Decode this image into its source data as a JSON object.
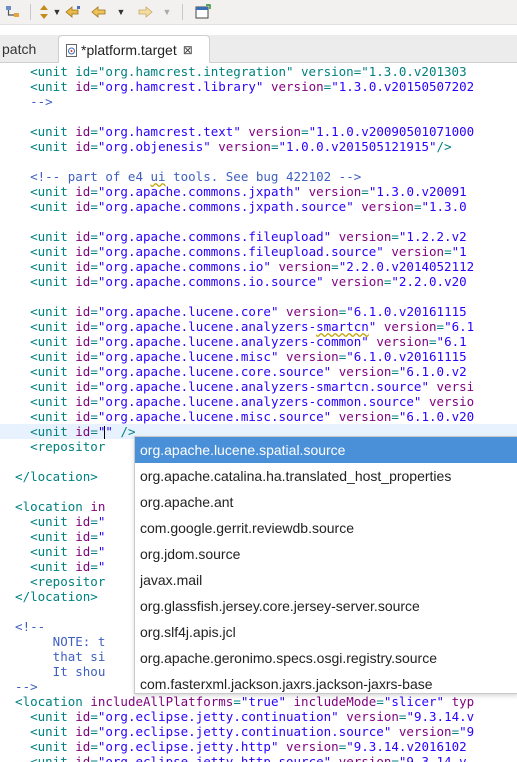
{
  "toolbar": {
    "icons": [
      "tree-hierarchy-icon",
      "last-edit-icon",
      "back-icon",
      "forward-icon",
      "new-window-icon"
    ]
  },
  "tabs": {
    "inactive_label": "patch",
    "active_label": "*platform.target",
    "close_glyph": "⊠"
  },
  "editor": {
    "lines": [
      [
        {
          "t": "    <unit id=\"org.hamcrest.integration\" version=\"1.3.0.v201303",
          "c": "tag"
        }
      ],
      [
        {
          "t": "    <unit ",
          "c": "tag"
        },
        {
          "t": "id",
          "c": "attr"
        },
        {
          "t": "=",
          "c": "tag"
        },
        {
          "t": "\"org.hamcrest.library\"",
          "c": "val"
        },
        {
          "t": " ",
          "c": "tag"
        },
        {
          "t": "version",
          "c": "attr"
        },
        {
          "t": "=",
          "c": "tag"
        },
        {
          "t": "\"1.3.0.v20150507202",
          "c": "val"
        }
      ],
      [
        {
          "t": "    -->",
          "c": "cmt"
        }
      ],
      [
        {
          "t": "",
          "c": "tag"
        }
      ],
      [
        {
          "t": "    <unit ",
          "c": "tag"
        },
        {
          "t": "id",
          "c": "attr"
        },
        {
          "t": "=",
          "c": "tag"
        },
        {
          "t": "\"org.hamcrest.text\"",
          "c": "val"
        },
        {
          "t": " ",
          "c": "tag"
        },
        {
          "t": "version",
          "c": "attr"
        },
        {
          "t": "=",
          "c": "tag"
        },
        {
          "t": "\"1.1.0.v20090501071000",
          "c": "val"
        }
      ],
      [
        {
          "t": "    <unit ",
          "c": "tag"
        },
        {
          "t": "id",
          "c": "attr"
        },
        {
          "t": "=",
          "c": "tag"
        },
        {
          "t": "\"org.objenesis\"",
          "c": "val"
        },
        {
          "t": " ",
          "c": "tag"
        },
        {
          "t": "version",
          "c": "attr"
        },
        {
          "t": "=",
          "c": "tag"
        },
        {
          "t": "\"1.0.0.v201505121915\"",
          "c": "val"
        },
        {
          "t": "/>",
          "c": "tag"
        }
      ],
      [
        {
          "t": "",
          "c": "tag"
        }
      ],
      [
        {
          "t": "    <!-- part of e4 ",
          "c": "cmt"
        },
        {
          "t": "ui",
          "c": "cmt ul"
        },
        {
          "t": " tools. See bug 422102 -->",
          "c": "cmt"
        }
      ],
      [
        {
          "t": "    <unit ",
          "c": "tag"
        },
        {
          "t": "id",
          "c": "attr"
        },
        {
          "t": "=",
          "c": "tag"
        },
        {
          "t": "\"org.apache.commons.jxpath\"",
          "c": "val"
        },
        {
          "t": " ",
          "c": "tag"
        },
        {
          "t": "version",
          "c": "attr"
        },
        {
          "t": "=",
          "c": "tag"
        },
        {
          "t": "\"1.3.0.v20091",
          "c": "val"
        }
      ],
      [
        {
          "t": "    <unit ",
          "c": "tag"
        },
        {
          "t": "id",
          "c": "attr"
        },
        {
          "t": "=",
          "c": "tag"
        },
        {
          "t": "\"org.apache.commons.jxpath.source\"",
          "c": "val"
        },
        {
          "t": " ",
          "c": "tag"
        },
        {
          "t": "version",
          "c": "attr"
        },
        {
          "t": "=",
          "c": "tag"
        },
        {
          "t": "\"1.3.0",
          "c": "val"
        }
      ],
      [
        {
          "t": "",
          "c": "tag"
        }
      ],
      [
        {
          "t": "    <unit ",
          "c": "tag"
        },
        {
          "t": "id",
          "c": "attr"
        },
        {
          "t": "=",
          "c": "tag"
        },
        {
          "t": "\"org.apache.commons.fileupload\"",
          "c": "val"
        },
        {
          "t": " ",
          "c": "tag"
        },
        {
          "t": "version",
          "c": "attr"
        },
        {
          "t": "=",
          "c": "tag"
        },
        {
          "t": "\"1.2.2.v2",
          "c": "val"
        }
      ],
      [
        {
          "t": "    <unit ",
          "c": "tag"
        },
        {
          "t": "id",
          "c": "attr"
        },
        {
          "t": "=",
          "c": "tag"
        },
        {
          "t": "\"org.apache.commons.fileupload.source\"",
          "c": "val"
        },
        {
          "t": " ",
          "c": "tag"
        },
        {
          "t": "version",
          "c": "attr"
        },
        {
          "t": "=",
          "c": "tag"
        },
        {
          "t": "\"1",
          "c": "val"
        }
      ],
      [
        {
          "t": "    <unit ",
          "c": "tag"
        },
        {
          "t": "id",
          "c": "attr"
        },
        {
          "t": "=",
          "c": "tag"
        },
        {
          "t": "\"org.apache.commons.io\"",
          "c": "val"
        },
        {
          "t": " ",
          "c": "tag"
        },
        {
          "t": "version",
          "c": "attr"
        },
        {
          "t": "=",
          "c": "tag"
        },
        {
          "t": "\"2.2.0.v2014052112",
          "c": "val"
        }
      ],
      [
        {
          "t": "    <unit ",
          "c": "tag"
        },
        {
          "t": "id",
          "c": "attr"
        },
        {
          "t": "=",
          "c": "tag"
        },
        {
          "t": "\"org.apache.commons.io.source\"",
          "c": "val"
        },
        {
          "t": " ",
          "c": "tag"
        },
        {
          "t": "version",
          "c": "attr"
        },
        {
          "t": "=",
          "c": "tag"
        },
        {
          "t": "\"2.2.0.v20",
          "c": "val"
        }
      ],
      [
        {
          "t": "",
          "c": "tag"
        }
      ],
      [
        {
          "t": "    <unit ",
          "c": "tag"
        },
        {
          "t": "id",
          "c": "attr"
        },
        {
          "t": "=",
          "c": "tag"
        },
        {
          "t": "\"org.apache.lucene.core\"",
          "c": "val"
        },
        {
          "t": " ",
          "c": "tag"
        },
        {
          "t": "version",
          "c": "attr"
        },
        {
          "t": "=",
          "c": "tag"
        },
        {
          "t": "\"6.1.0.v20161115",
          "c": "val"
        }
      ],
      [
        {
          "t": "    <unit ",
          "c": "tag"
        },
        {
          "t": "id",
          "c": "attr"
        },
        {
          "t": "=",
          "c": "tag"
        },
        {
          "t": "\"org.apache.lucene.analyzers-",
          "c": "val"
        },
        {
          "t": "smartcn",
          "c": "val ul"
        },
        {
          "t": "\"",
          "c": "val"
        },
        {
          "t": " ",
          "c": "tag"
        },
        {
          "t": "version",
          "c": "attr"
        },
        {
          "t": "=",
          "c": "tag"
        },
        {
          "t": "\"6.1",
          "c": "val"
        }
      ],
      [
        {
          "t": "    <unit ",
          "c": "tag"
        },
        {
          "t": "id",
          "c": "attr"
        },
        {
          "t": "=",
          "c": "tag"
        },
        {
          "t": "\"org.apache.lucene.analyzers-common\"",
          "c": "val"
        },
        {
          "t": " ",
          "c": "tag"
        },
        {
          "t": "version",
          "c": "attr"
        },
        {
          "t": "=",
          "c": "tag"
        },
        {
          "t": "\"6.1",
          "c": "val"
        }
      ],
      [
        {
          "t": "    <unit ",
          "c": "tag"
        },
        {
          "t": "id",
          "c": "attr"
        },
        {
          "t": "=",
          "c": "tag"
        },
        {
          "t": "\"org.apache.lucene.misc\"",
          "c": "val"
        },
        {
          "t": " ",
          "c": "tag"
        },
        {
          "t": "version",
          "c": "attr"
        },
        {
          "t": "=",
          "c": "tag"
        },
        {
          "t": "\"6.1.0.v20161115",
          "c": "val"
        }
      ],
      [
        {
          "t": "    <unit ",
          "c": "tag"
        },
        {
          "t": "id",
          "c": "attr"
        },
        {
          "t": "=",
          "c": "tag"
        },
        {
          "t": "\"org.apache.lucene.core.source\"",
          "c": "val"
        },
        {
          "t": " ",
          "c": "tag"
        },
        {
          "t": "version",
          "c": "attr"
        },
        {
          "t": "=",
          "c": "tag"
        },
        {
          "t": "\"6.1.0.v2",
          "c": "val"
        }
      ],
      [
        {
          "t": "    <unit ",
          "c": "tag"
        },
        {
          "t": "id",
          "c": "attr"
        },
        {
          "t": "=",
          "c": "tag"
        },
        {
          "t": "\"org.apache.lucene.analyzers-smartcn.source\"",
          "c": "val"
        },
        {
          "t": " ",
          "c": "tag"
        },
        {
          "t": "versi",
          "c": "attr"
        }
      ],
      [
        {
          "t": "    <unit ",
          "c": "tag"
        },
        {
          "t": "id",
          "c": "attr"
        },
        {
          "t": "=",
          "c": "tag"
        },
        {
          "t": "\"org.apache.lucene.analyzers-common.source\"",
          "c": "val"
        },
        {
          "t": " ",
          "c": "tag"
        },
        {
          "t": "versio",
          "c": "attr"
        }
      ],
      [
        {
          "t": "    <unit ",
          "c": "tag"
        },
        {
          "t": "id",
          "c": "attr"
        },
        {
          "t": "=",
          "c": "tag"
        },
        {
          "t": "\"org.apache.lucene.misc.source\"",
          "c": "val"
        },
        {
          "t": " ",
          "c": "tag"
        },
        {
          "t": "version",
          "c": "attr"
        },
        {
          "t": "=",
          "c": "tag"
        },
        {
          "t": "\"6.1.0.v20",
          "c": "val"
        }
      ],
      [
        {
          "t": "    <unit ",
          "c": "tag"
        },
        {
          "t": "id",
          "c": "attr"
        },
        {
          "t": "=",
          "c": "tag"
        },
        {
          "t": "\"",
          "c": "val"
        },
        {
          "t": "CARET",
          "c": "caret"
        },
        {
          "t": "\"",
          "c": "val"
        },
        {
          "t": " />",
          "c": "tag"
        }
      ],
      [
        {
          "t": "    <repositor",
          "c": "tag"
        }
      ],
      [
        {
          "t": "",
          "c": "tag"
        }
      ],
      [
        {
          "t": "  </location>",
          "c": "tag"
        }
      ],
      [
        {
          "t": "",
          "c": "tag"
        }
      ],
      [
        {
          "t": "  <location ",
          "c": "tag"
        },
        {
          "t": "in",
          "c": "attr"
        }
      ],
      [
        {
          "t": "    <unit ",
          "c": "tag"
        },
        {
          "t": "id",
          "c": "attr"
        },
        {
          "t": "=",
          "c": "tag"
        },
        {
          "t": "\"",
          "c": "val"
        }
      ],
      [
        {
          "t": "    <unit ",
          "c": "tag"
        },
        {
          "t": "id",
          "c": "attr"
        },
        {
          "t": "=",
          "c": "tag"
        },
        {
          "t": "\"",
          "c": "val"
        }
      ],
      [
        {
          "t": "    <unit ",
          "c": "tag"
        },
        {
          "t": "id",
          "c": "attr"
        },
        {
          "t": "=",
          "c": "tag"
        },
        {
          "t": "\"",
          "c": "val"
        }
      ],
      [
        {
          "t": "    <unit ",
          "c": "tag"
        },
        {
          "t": "id",
          "c": "attr"
        },
        {
          "t": "=",
          "c": "tag"
        },
        {
          "t": "\"",
          "c": "val"
        }
      ],
      [
        {
          "t": "    <repositor",
          "c": "tag"
        }
      ],
      [
        {
          "t": "  </location>",
          "c": "tag"
        }
      ],
      [
        {
          "t": "",
          "c": "tag"
        }
      ],
      [
        {
          "t": "  <!--",
          "c": "cmt"
        }
      ],
      [
        {
          "t": "       NOTE: t",
          "c": "cmt"
        }
      ],
      [
        {
          "t": "       that si",
          "c": "cmt"
        }
      ],
      [
        {
          "t": "       It shou",
          "c": "cmt"
        }
      ],
      [
        {
          "t": "  -->",
          "c": "cmt"
        }
      ],
      [
        {
          "t": "  <location ",
          "c": "tag"
        },
        {
          "t": "includeAllPlatforms",
          "c": "attr"
        },
        {
          "t": "=",
          "c": "tag"
        },
        {
          "t": "\"true\"",
          "c": "val"
        },
        {
          "t": " ",
          "c": "tag"
        },
        {
          "t": "includeMode",
          "c": "attr"
        },
        {
          "t": "=",
          "c": "tag"
        },
        {
          "t": "\"slicer\"",
          "c": "val"
        },
        {
          "t": " ",
          "c": "tag"
        },
        {
          "t": "typ",
          "c": "attr"
        }
      ],
      [
        {
          "t": "    <unit ",
          "c": "tag"
        },
        {
          "t": "id",
          "c": "attr"
        },
        {
          "t": "=",
          "c": "tag"
        },
        {
          "t": "\"org.eclipse.jetty.continuation\"",
          "c": "val"
        },
        {
          "t": " ",
          "c": "tag"
        },
        {
          "t": "version",
          "c": "attr"
        },
        {
          "t": "=",
          "c": "tag"
        },
        {
          "t": "\"9.3.14.v",
          "c": "val"
        }
      ],
      [
        {
          "t": "    <unit ",
          "c": "tag"
        },
        {
          "t": "id",
          "c": "attr"
        },
        {
          "t": "=",
          "c": "tag"
        },
        {
          "t": "\"org.eclipse.jetty.continuation.source\"",
          "c": "val"
        },
        {
          "t": " ",
          "c": "tag"
        },
        {
          "t": "version",
          "c": "attr"
        },
        {
          "t": "=",
          "c": "tag"
        },
        {
          "t": "\"9",
          "c": "val"
        }
      ],
      [
        {
          "t": "    <unit ",
          "c": "tag"
        },
        {
          "t": "id",
          "c": "attr"
        },
        {
          "t": "=",
          "c": "tag"
        },
        {
          "t": "\"org.eclipse.jetty.http\"",
          "c": "val"
        },
        {
          "t": " ",
          "c": "tag"
        },
        {
          "t": "version",
          "c": "attr"
        },
        {
          "t": "=",
          "c": "tag"
        },
        {
          "t": "\"9.3.14.v2016102",
          "c": "val"
        }
      ],
      [
        {
          "t": "    <unit ",
          "c": "tag"
        },
        {
          "t": "id",
          "c": "attr"
        },
        {
          "t": "=",
          "c": "tag"
        },
        {
          "t": "\"org.eclipse.jetty.http.source\"",
          "c": "val"
        },
        {
          "t": " ",
          "c": "tag"
        },
        {
          "t": "version",
          "c": "attr"
        },
        {
          "t": "=",
          "c": "tag"
        },
        {
          "t": "\"9.3.14.v",
          "c": "val"
        }
      ]
    ]
  },
  "autocomplete": {
    "selected_index": 0,
    "items": [
      "org.apache.lucene.spatial.source",
      "org.apache.catalina.ha.translated_host_properties",
      "org.apache.ant",
      "com.google.gerrit.reviewdb.source",
      "org.jdom.source",
      "javax.mail",
      "org.glassfish.jersey.core.jersey-server.source",
      "org.slf4j.apis.jcl",
      "org.apache.geronimo.specs.osgi.registry.source",
      "com.fasterxml.jackson.jaxrs.jackson-jaxrs-base"
    ]
  }
}
